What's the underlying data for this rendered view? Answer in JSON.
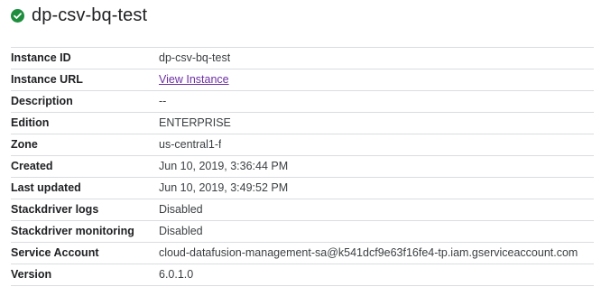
{
  "colors": {
    "status_ok": "#1e8e3e",
    "link": "#6b2fa3",
    "divider": "#dadce0"
  },
  "header": {
    "status_icon": "check-circle-icon",
    "title": "dp-csv-bq-test"
  },
  "details": [
    {
      "label": "Instance ID",
      "value": "dp-csv-bq-test",
      "is_link": false
    },
    {
      "label": "Instance URL",
      "value": "View Instance",
      "is_link": true
    },
    {
      "label": "Description",
      "value": "--",
      "is_link": false
    },
    {
      "label": "Edition",
      "value": "ENTERPRISE",
      "is_link": false
    },
    {
      "label": "Zone",
      "value": "us-central1-f",
      "is_link": false
    },
    {
      "label": "Created",
      "value": "Jun 10, 2019, 3:36:44 PM",
      "is_link": false
    },
    {
      "label": "Last updated",
      "value": "Jun 10, 2019, 3:49:52 PM",
      "is_link": false
    },
    {
      "label": "Stackdriver logs",
      "value": "Disabled",
      "is_link": false
    },
    {
      "label": "Stackdriver monitoring",
      "value": "Disabled",
      "is_link": false
    },
    {
      "label": "Service Account",
      "value": "cloud-datafusion-management-sa@k541dcf9e63f16fe4-tp.iam.gserviceaccount.com",
      "is_link": false
    },
    {
      "label": "Version",
      "value": "6.0.1.0",
      "is_link": false
    }
  ]
}
